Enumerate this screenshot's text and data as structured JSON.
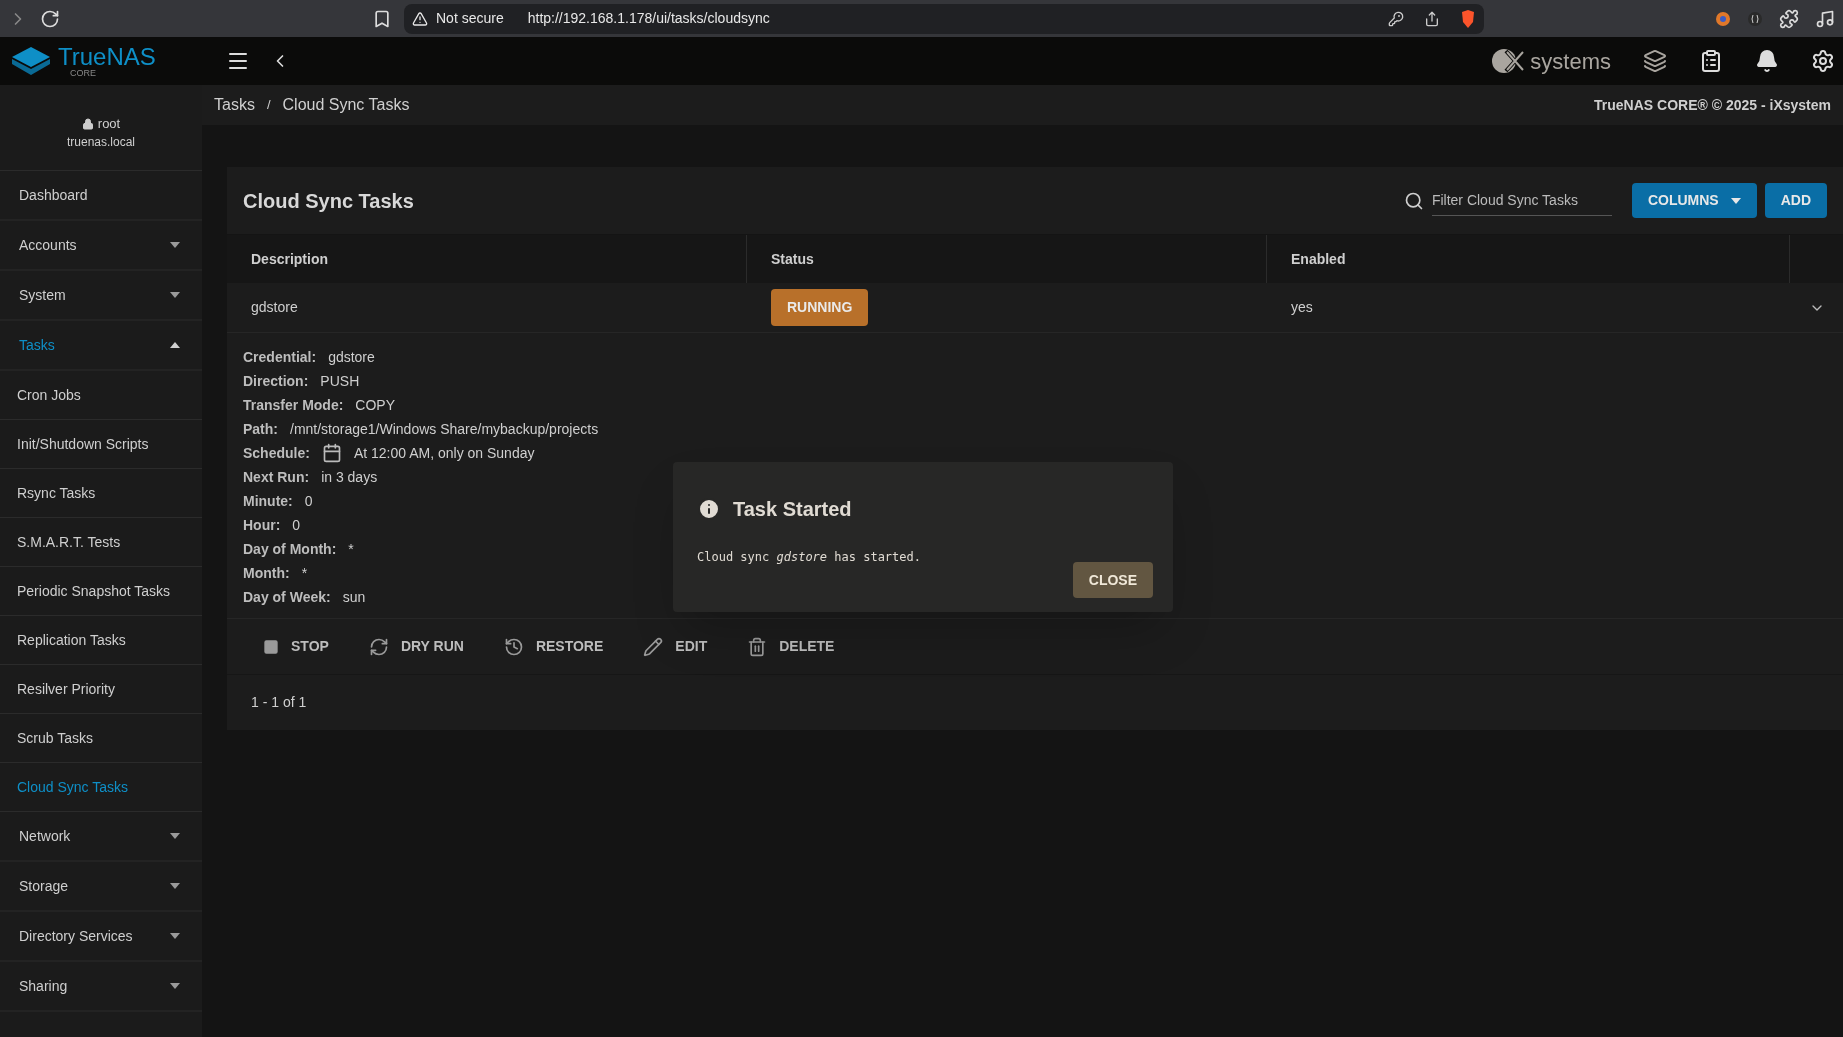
{
  "browser": {
    "security": "Not secure",
    "url": "http://192.168.1.178/ui/tasks/cloudsync"
  },
  "header": {
    "logo": "TrueNAS",
    "logo_sub": "CORE",
    "vendor": "systems"
  },
  "breadcrumb": [
    "Tasks",
    "Cloud Sync Tasks"
  ],
  "breadcrumb_separator": "/",
  "copyright": "TrueNAS CORE® © 2025 - iXsystem",
  "user": {
    "name": "root",
    "host": "truenas.local"
  },
  "sidebar": [
    {
      "label": "Dashboard",
      "kind": "top",
      "selected": false
    },
    {
      "label": "Accounts",
      "kind": "group",
      "expanded": false,
      "selected": false
    },
    {
      "label": "System",
      "kind": "group",
      "expanded": false,
      "selected": false
    },
    {
      "label": "Tasks",
      "kind": "group",
      "expanded": true,
      "selected": true,
      "children": [
        {
          "label": "Cron Jobs",
          "selected": false
        },
        {
          "label": "Init/Shutdown Scripts",
          "selected": false
        },
        {
          "label": "Rsync Tasks",
          "selected": false
        },
        {
          "label": "S.M.A.R.T. Tests",
          "selected": false
        },
        {
          "label": "Periodic Snapshot Tasks",
          "selected": false
        },
        {
          "label": "Replication Tasks",
          "selected": false
        },
        {
          "label": "Resilver Priority",
          "selected": false
        },
        {
          "label": "Scrub Tasks",
          "selected": false
        },
        {
          "label": "Cloud Sync Tasks",
          "selected": true
        }
      ]
    },
    {
      "label": "Network",
      "kind": "group",
      "expanded": false,
      "selected": false
    },
    {
      "label": "Storage",
      "kind": "group",
      "expanded": false,
      "selected": false
    },
    {
      "label": "Directory Services",
      "kind": "group",
      "expanded": false,
      "selected": false
    },
    {
      "label": "Sharing",
      "kind": "group",
      "expanded": false,
      "selected": false
    }
  ],
  "card": {
    "title": "Cloud Sync Tasks",
    "filter_placeholder": "Filter Cloud Sync Tasks",
    "columns_button": "COLUMNS",
    "add_button": "ADD"
  },
  "table": {
    "columns": [
      "Description",
      "Status",
      "Enabled"
    ],
    "rows": [
      {
        "description": "gdstore",
        "status": "RUNNING",
        "enabled": "yes",
        "expanded": true
      }
    ]
  },
  "details": [
    {
      "label": "Credential:",
      "value": "gdstore"
    },
    {
      "label": "Direction:",
      "value": "PUSH"
    },
    {
      "label": "Transfer Mode:",
      "value": "COPY"
    },
    {
      "label": "Path:",
      "value": "/mnt/storage1/Windows Share/mybackup/projects"
    },
    {
      "label": "Schedule:",
      "value": "At 12:00 AM, only on Sunday",
      "kind": "schedule"
    },
    {
      "label": "Next Run:",
      "value": "in 3 days"
    },
    {
      "label": "Minute:",
      "value": "0"
    },
    {
      "label": "Hour:",
      "value": "0"
    },
    {
      "label": "Day of Month:",
      "value": "*"
    },
    {
      "label": "Month:",
      "value": "*"
    },
    {
      "label": "Day of Week:",
      "value": "sun"
    }
  ],
  "actions": [
    {
      "label": "STOP",
      "kind": "stop"
    },
    {
      "label": "DRY RUN",
      "kind": "dryrun"
    },
    {
      "label": "RESTORE",
      "kind": "restore"
    },
    {
      "label": "EDIT",
      "kind": "edit"
    },
    {
      "label": "DELETE",
      "kind": "delete"
    }
  ],
  "pagination": "1 - 1 of 1",
  "dialog": {
    "title": "Task Started",
    "message": "Cloud sync *gdstore* has started.",
    "button": "CLOSE"
  }
}
